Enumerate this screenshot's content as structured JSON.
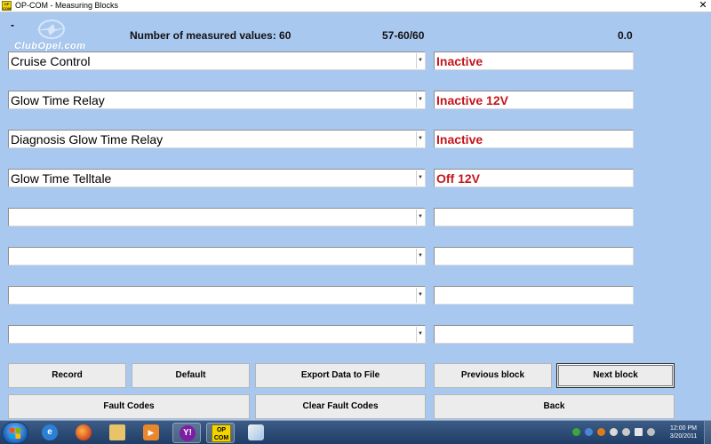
{
  "window": {
    "title": "OP-COM - Measuring Blocks",
    "app_icon_text": "OP COM",
    "close_glyph": "✕"
  },
  "header": {
    "dash": "-",
    "logo_text": "ClubOpel.com",
    "measured_count": "Number of measured values: 60",
    "range": "57-60/60",
    "value": "0.0"
  },
  "rows": [
    {
      "label": "Cruise Control",
      "value": "Inactive"
    },
    {
      "label": "Glow Time Relay",
      "value": "Inactive 12V"
    },
    {
      "label": "Diagnosis Glow Time Relay",
      "value": "Inactive"
    },
    {
      "label": "Glow Time Telltale",
      "value": "Off 12V"
    },
    {
      "label": "",
      "value": ""
    },
    {
      "label": "",
      "value": ""
    },
    {
      "label": "",
      "value": ""
    },
    {
      "label": "",
      "value": ""
    }
  ],
  "buttons": {
    "record": "Record",
    "default": "Default",
    "export": "Export Data to File",
    "previous": "Previous block",
    "next": "Next block",
    "fault_codes": "Fault Codes",
    "clear_fault_codes": "Clear Fault Codes",
    "back": "Back"
  },
  "taskbar": {
    "icons": [
      "internet-explorer-icon",
      "firefox-icon",
      "folder-icon",
      "media-player-icon",
      "yahoo-messenger-icon",
      "op-com-icon",
      "paint-icon"
    ],
    "opcom_label_top": "OP",
    "opcom_label_bottom": "COM",
    "clock_time": "12:00 PM",
    "clock_date": "3/20/2011"
  },
  "colors": {
    "background": "#a9c8f0",
    "value_text": "#c4161c",
    "button_face": "#ececec"
  }
}
